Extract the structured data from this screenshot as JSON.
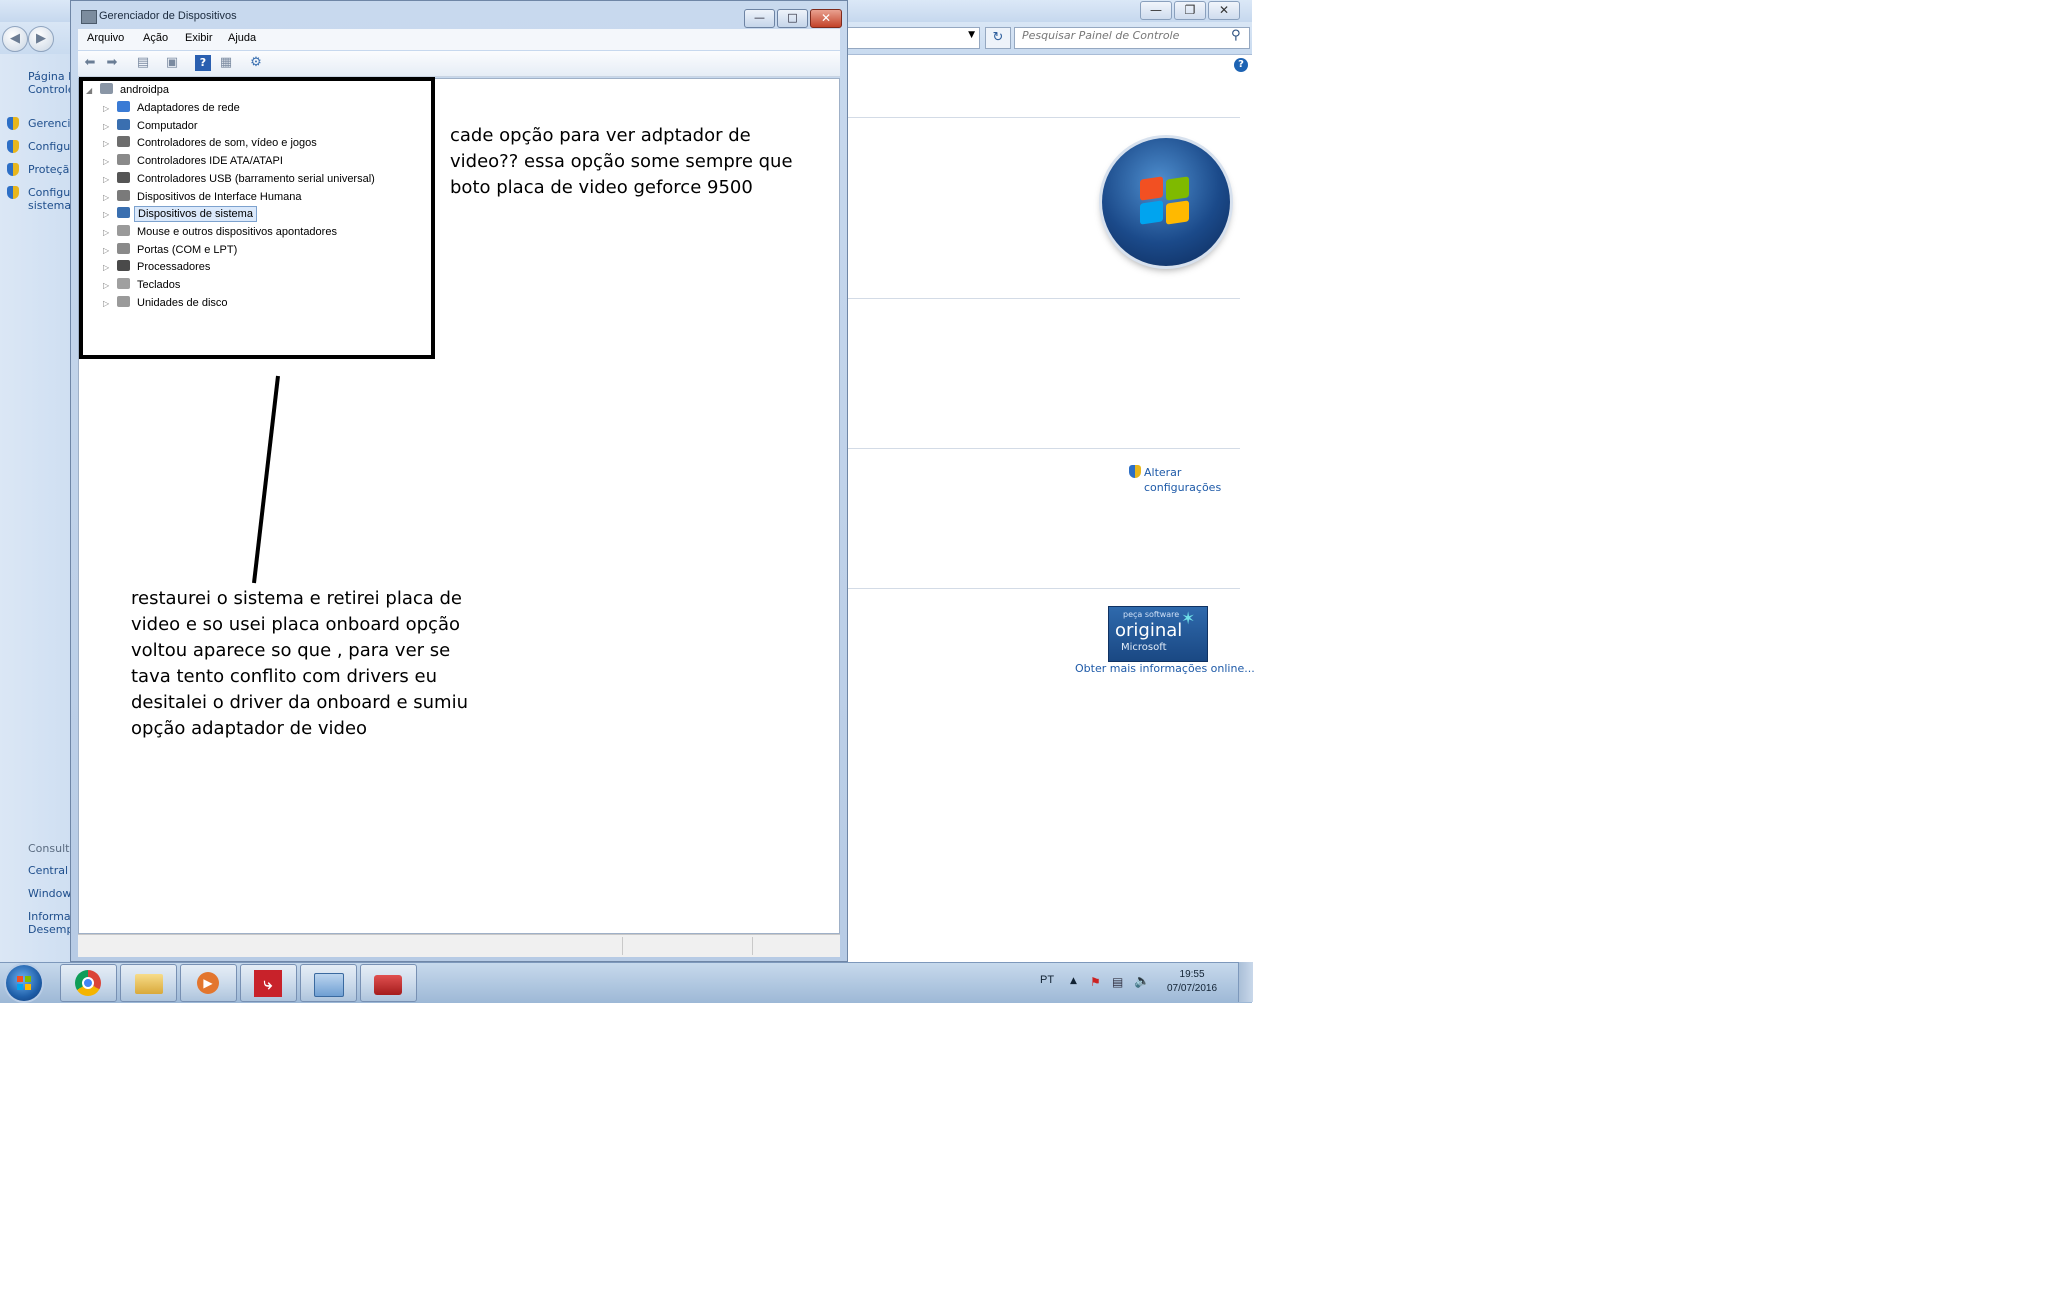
{
  "control_panel": {
    "search_placeholder": "Pesquisar Painel de Controle",
    "left_links": [
      {
        "label": "Página I",
        "line2": "Controle"
      },
      {
        "label": "Gerencia"
      },
      {
        "label": "Configu"
      },
      {
        "label": "Proteção"
      },
      {
        "label": "Configu",
        "line2": "sistema"
      }
    ],
    "see_also_title": "Consult",
    "see_also_links": [
      "Central",
      "Window",
      "Informa"
    ],
    "see_also_last_line2": "Desemp",
    "alterar_line1": "Alterar",
    "alterar_line2": "configurações",
    "badge_top": "peça software",
    "badge_main": "original",
    "badge_sub": "Microsoft",
    "obter_link": "Obter mais informações online..."
  },
  "device_manager": {
    "title": "Gerenciador de Dispositivos",
    "menu": [
      "Arquivo",
      "Ação",
      "Exibir",
      "Ajuda"
    ],
    "root": "androidpa",
    "items": [
      {
        "label": "Adaptadores de rede",
        "icon": "network-adapter-icon",
        "color": "#3a7bd5"
      },
      {
        "label": "Computador",
        "icon": "computer-icon",
        "color": "#3a6fb0"
      },
      {
        "label": "Controladores de som, vídeo e jogos",
        "icon": "speaker-icon",
        "color": "#6d6d6d"
      },
      {
        "label": "Controladores IDE ATA/ATAPI",
        "icon": "ide-controller-icon",
        "color": "#8a8a8a"
      },
      {
        "label": "Controladores USB (barramento serial universal)",
        "icon": "usb-icon",
        "color": "#555555"
      },
      {
        "label": "Dispositivos de Interface Humana",
        "icon": "hid-icon",
        "color": "#7a7a7a"
      },
      {
        "label": "Dispositivos de sistema",
        "icon": "system-devices-icon",
        "color": "#3a6fb0",
        "selected": true
      },
      {
        "label": "Mouse e outros dispositivos apontadores",
        "icon": "mouse-icon",
        "color": "#9a9a9a"
      },
      {
        "label": "Portas (COM e LPT)",
        "icon": "ports-icon",
        "color": "#8a8a8a"
      },
      {
        "label": "Processadores",
        "icon": "processor-icon",
        "color": "#4a4a4a"
      },
      {
        "label": "Teclados",
        "icon": "keyboard-icon",
        "color": "#a0a0a0"
      },
      {
        "label": "Unidades de disco",
        "icon": "disk-drive-icon",
        "color": "#9a9a9a"
      }
    ]
  },
  "annotations": {
    "note1": [
      "cade opção para ver adptador de",
      "video?? essa opção some sempre que",
      "boto placa de video geforce 9500"
    ],
    "note2": [
      "restaurei o sistema e retirei placa de",
      "video e so usei placa onboard opção",
      "voltou aparece so que , para ver se",
      "tava tento conflito com drivers eu",
      "desitalei o driver da onboard e sumiu",
      "opção adaptador de video"
    ]
  },
  "taskbar": {
    "apps": [
      "chrome-icon",
      "explorer-folder-icon",
      "media-player-icon",
      "flash-app-icon",
      "control-panel-icon",
      "toolbox-icon"
    ],
    "language": "PT",
    "time": "19:55",
    "date": "07/07/2016"
  }
}
